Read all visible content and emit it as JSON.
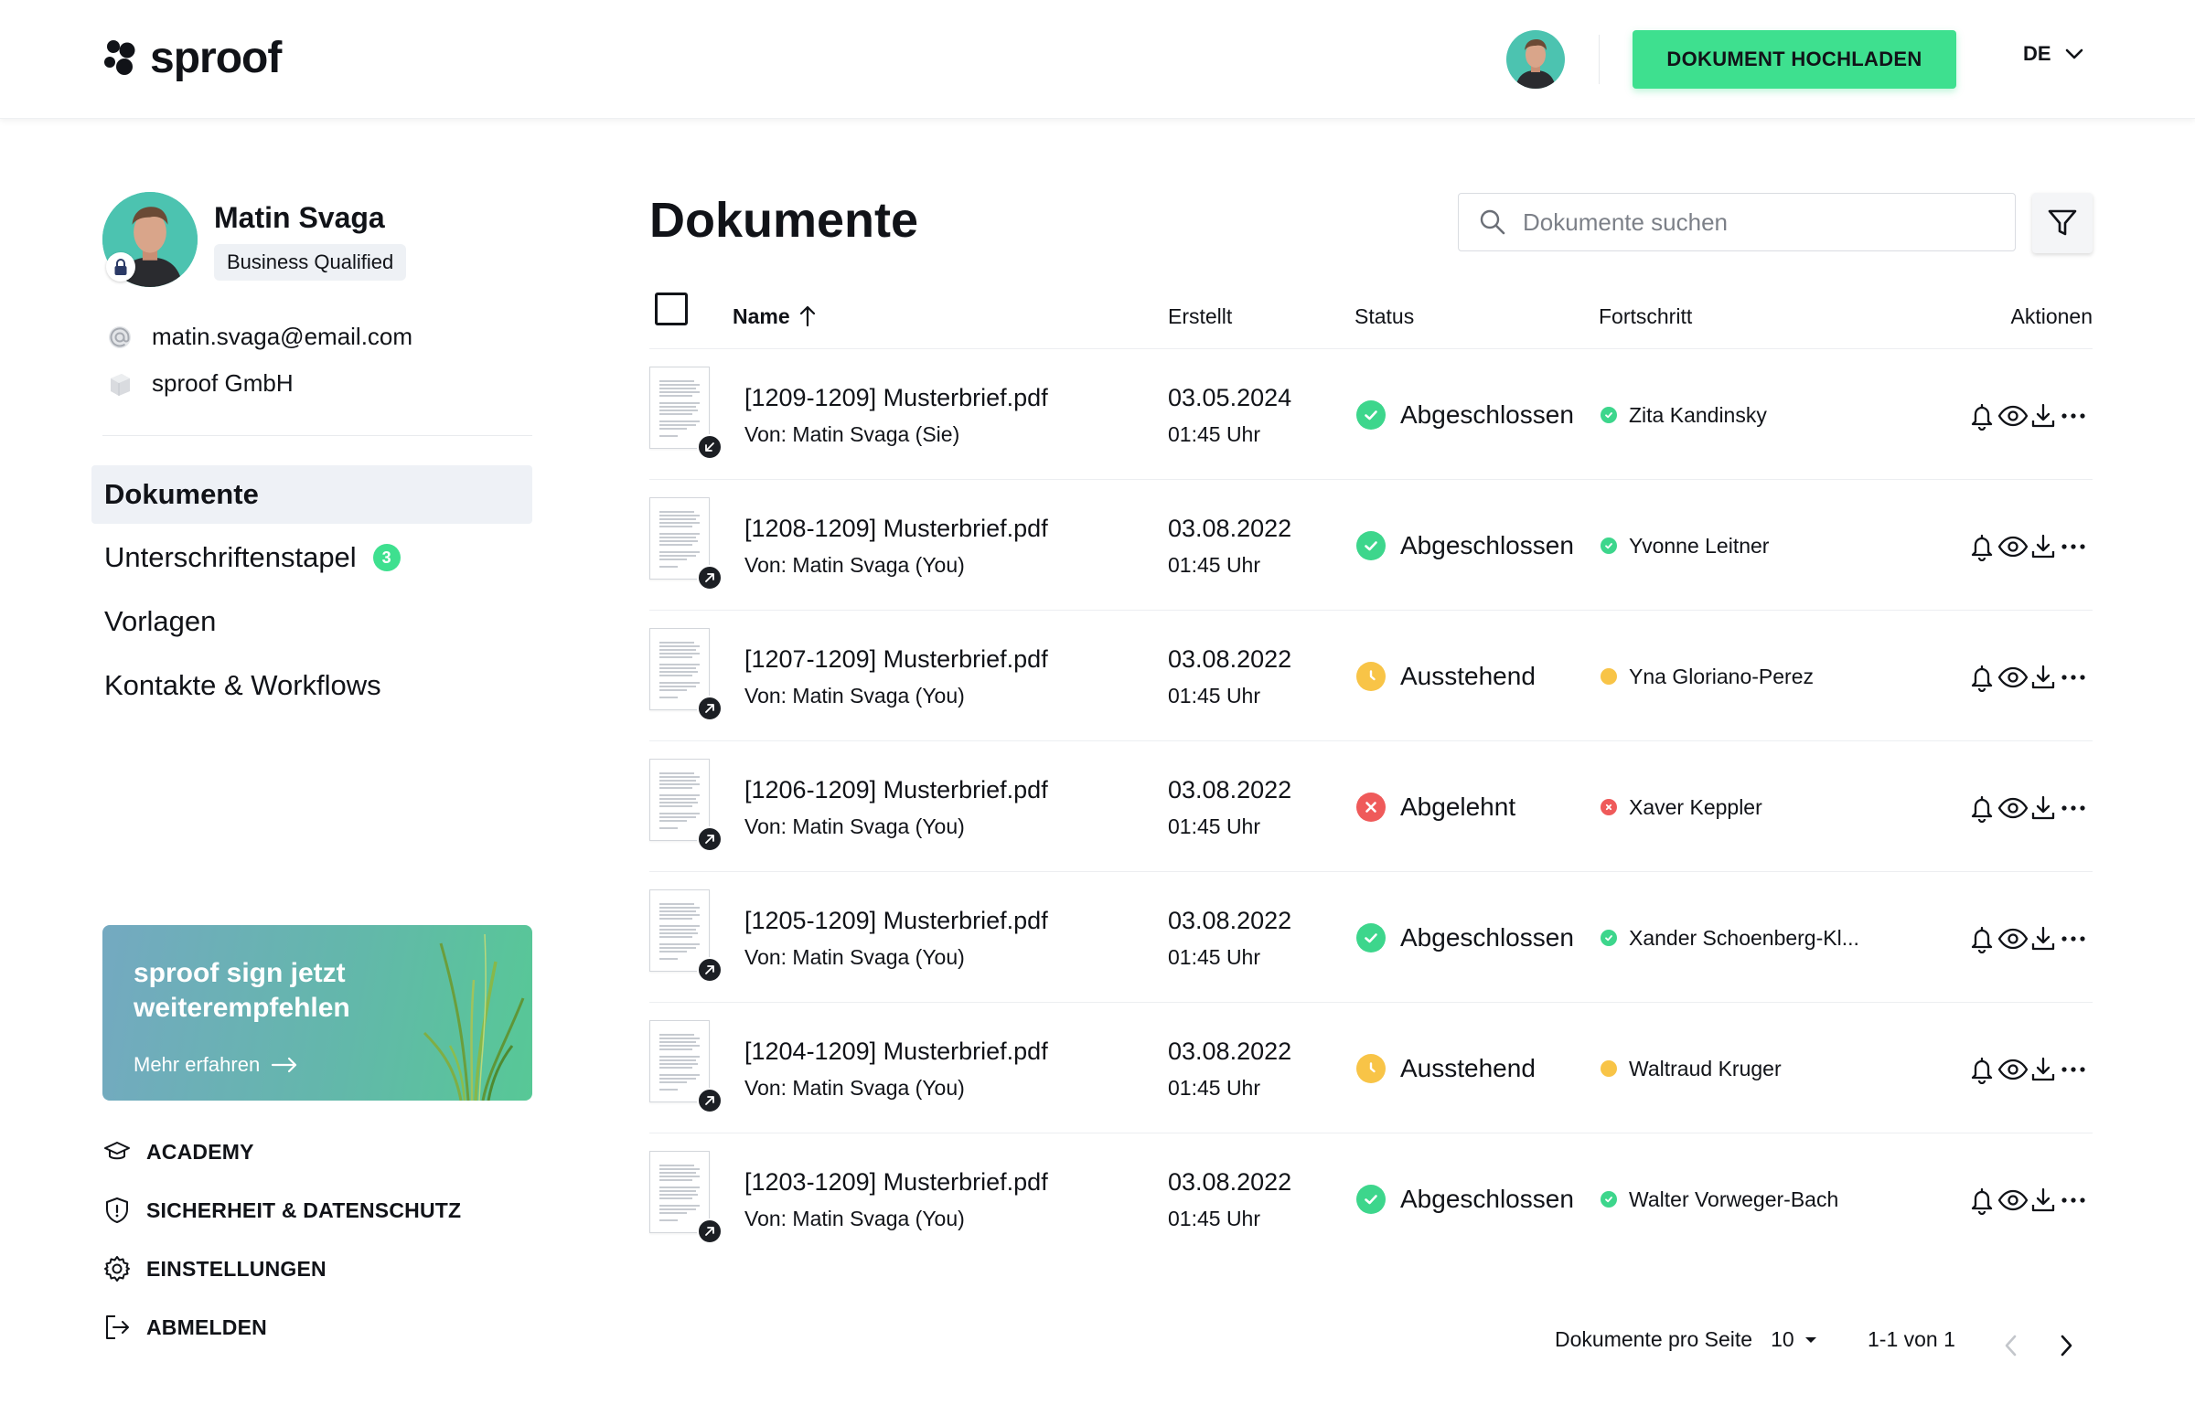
{
  "header": {
    "logo_text": "sproof",
    "upload_button": "DOKUMENT HOCHLADEN",
    "language": "DE"
  },
  "profile": {
    "name": "Matin Svaga",
    "badge": "Business Qualified",
    "email": "matin.svaga@email.com",
    "company": "sproof GmbH"
  },
  "nav": {
    "items": [
      {
        "label": "Dokumente",
        "active": true
      },
      {
        "label": "Unterschriftenstapel",
        "count": "3"
      },
      {
        "label": "Vorlagen"
      },
      {
        "label": "Kontakte & Workflows"
      }
    ]
  },
  "promo": {
    "title": "sproof sign jetzt weiterempfehlen",
    "link": "Mehr erfahren"
  },
  "footer_links": {
    "academy": "ACADEMY",
    "security": "SICHERHEIT & DATENSCHUTZ",
    "settings": "EINSTELLUNGEN",
    "logout": "ABMELDEN"
  },
  "main": {
    "title": "Dokumente",
    "search_placeholder": "Dokumente suchen",
    "columns": {
      "name": "Name",
      "created": "Erstellt",
      "status": "Status",
      "progress": "Fortschritt",
      "actions": "Aktionen"
    },
    "rows": [
      {
        "file": "[1209-1209] Musterbrief.pdf",
        "sender": "Von: Matin Svaga (Sie)",
        "date": "03.05.2024",
        "time": "01:45 Uhr",
        "status": "Abgeschlossen",
        "status_type": "done",
        "signer": "Zita Kandinsky",
        "direction": "incoming"
      },
      {
        "file": "[1208-1209] Musterbrief.pdf",
        "sender": "Von: Matin Svaga (You)",
        "date": "03.08.2022",
        "time": "01:45 Uhr",
        "status": "Abgeschlossen",
        "status_type": "done",
        "signer": "Yvonne Leitner",
        "direction": "outgoing"
      },
      {
        "file": "[1207-1209] Musterbrief.pdf",
        "sender": "Von: Matin Svaga (You)",
        "date": "03.08.2022",
        "time": "01:45 Uhr",
        "status": "Ausstehend",
        "status_type": "pending",
        "signer": "Yna Gloriano-Perez",
        "direction": "outgoing"
      },
      {
        "file": "[1206-1209] Musterbrief.pdf",
        "sender": "Von: Matin Svaga (You)",
        "date": "03.08.2022",
        "time": "01:45 Uhr",
        "status": "Abgelehnt",
        "status_type": "rejected",
        "signer": "Xaver Keppler",
        "direction": "outgoing"
      },
      {
        "file": "[1205-1209] Musterbrief.pdf",
        "sender": "Von: Matin Svaga (You)",
        "date": "03.08.2022",
        "time": "01:45 Uhr",
        "status": "Abgeschlossen",
        "status_type": "done",
        "signer": "Xander Schoenberg-Kl...",
        "direction": "outgoing"
      },
      {
        "file": "[1204-1209] Musterbrief.pdf",
        "sender": "Von: Matin Svaga (You)",
        "date": "03.08.2022",
        "time": "01:45 Uhr",
        "status": "Ausstehend",
        "status_type": "pending",
        "signer": "Waltraud Kruger",
        "direction": "outgoing"
      },
      {
        "file": "[1203-1209] Musterbrief.pdf",
        "sender": "Von: Matin Svaga (You)",
        "date": "03.08.2022",
        "time": "01:45 Uhr",
        "status": "Abgeschlossen",
        "status_type": "done",
        "signer": "Walter Vorweger-Bach",
        "direction": "outgoing"
      }
    ]
  },
  "pagination": {
    "per_page_label": "Dokumente pro Seite",
    "per_page_value": "10",
    "range": "1-1 von 1"
  },
  "colors": {
    "accent": "#3ee08f",
    "done": "#3dd68c",
    "pending": "#f8c447",
    "rejected": "#ef5a5a"
  },
  "icons": {
    "row_actions": [
      "bell-icon",
      "eye-icon",
      "download-icon",
      "more-icon"
    ]
  }
}
